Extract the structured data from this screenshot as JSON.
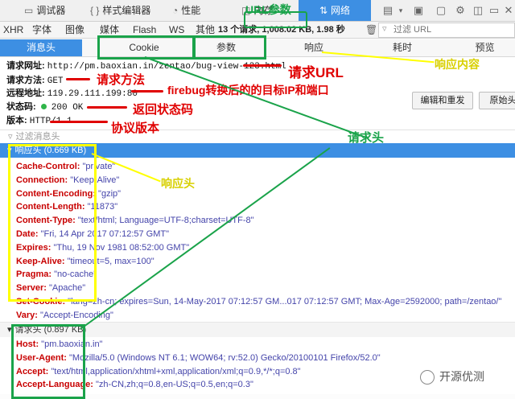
{
  "devtools": {
    "tabs": [
      {
        "icon": "console-icon",
        "label": "调试器"
      },
      {
        "icon": "braces-icon",
        "label": "样式编辑器"
      },
      {
        "icon": "gauge-icon",
        "label": "性能"
      },
      {
        "icon": "memory-icon",
        "label": "内存"
      },
      {
        "icon": "network-icon",
        "label": "网络"
      }
    ],
    "active_tab": "网络",
    "accent_color": "#3d8fe3",
    "right_icons": [
      "split-console-icon",
      "responsive-icon",
      "settings-icon",
      "dock-icon",
      "close-icon"
    ]
  },
  "filter": {
    "types": [
      "XHR",
      "字体",
      "图像",
      "媒体",
      "Flash",
      "WS",
      "其他"
    ],
    "summary": "13 个请求, 1,008.02 KB, 1.98 秒",
    "url_placeholder": "过滤 URL"
  },
  "detail_tabs": [
    "消息头",
    "Cookie",
    "参数",
    "响应",
    "耗时",
    "预览"
  ],
  "active_detail_tab": "消息头",
  "summary": {
    "request_url_label": "请求网址:",
    "request_url": "http://pm.baoxian.in/zentao/bug-view-123.html",
    "method_label": "请求方法:",
    "method": "GET",
    "remote_label": "远程地址:",
    "remote": "119.29.111.199:80",
    "status_label": "状态码:",
    "status": "200 OK",
    "version_label": "版本:",
    "version": "HTTP/1.1"
  },
  "buttons": {
    "edit_resend": "编辑和重发",
    "raw": "原始头"
  },
  "headers_filter_placeholder": "过滤消息头",
  "response_headers": {
    "title": "响应头 (0.669 KB)",
    "items": [
      {
        "key": "Cache-Control:",
        "value": "\"private\""
      },
      {
        "key": "Connection:",
        "value": "\"Keep-Alive\""
      },
      {
        "key": "Content-Encoding:",
        "value": "\"gzip\""
      },
      {
        "key": "Content-Length:",
        "value": "\"11873\""
      },
      {
        "key": "Content-Type:",
        "value": "\"text/html; Language=UTF-8;charset=UTF-8\""
      },
      {
        "key": "Date:",
        "value": "\"Fri, 14 Apr 2017 07:12:57 GMT\""
      },
      {
        "key": "Expires:",
        "value": "\"Thu, 19 Nov 1981 08:52:00 GMT\""
      },
      {
        "key": "Keep-Alive:",
        "value": "\"timeout=5, max=100\""
      },
      {
        "key": "Pragma:",
        "value": "\"no-cache\""
      },
      {
        "key": "Server:",
        "value": "\"Apache\""
      },
      {
        "key": "Set-Cookie:",
        "value": "\"lang=zh-cn; expires=Sun, 14-May-2017 07:12:57 GM...017 07:12:57 GMT; Max-Age=2592000; path=/zentao/\""
      },
      {
        "key": "Vary:",
        "value": "\"Accept-Encoding\""
      }
    ]
  },
  "request_headers": {
    "title": "请求头 (0.897 KB)",
    "items": [
      {
        "key": "Host:",
        "value": "\"pm.baoxian.in\""
      },
      {
        "key": "User-Agent:",
        "value": "\"Mozilla/5.0 (Windows NT 6.1; WOW64; rv:52.0) Gecko/20100101 Firefox/52.0\""
      },
      {
        "key": "Accept:",
        "value": "\"text/html,application/xhtml+xml,application/xml;q=0.9,*/*;q=0.8\""
      },
      {
        "key": "Accept-Language:",
        "value": "\"zh-CN,zh;q=0.8,en-US;q=0.5,en;q=0.3\""
      }
    ]
  },
  "annotations": {
    "url_params": "URL参数",
    "response_content": "响应内容",
    "request_url": "请求URL",
    "request_method": "请求方法",
    "firebug_target": "firebug转换后的的目标IP和端口",
    "status_code": "返回状态码",
    "protocol_version": "协议版本",
    "request_header": "请求头",
    "response_header": "响应头",
    "colors": {
      "red": "#e00000",
      "green": "#1aa34a",
      "yellow": "#ffff00"
    }
  },
  "watermark": "开源优测"
}
